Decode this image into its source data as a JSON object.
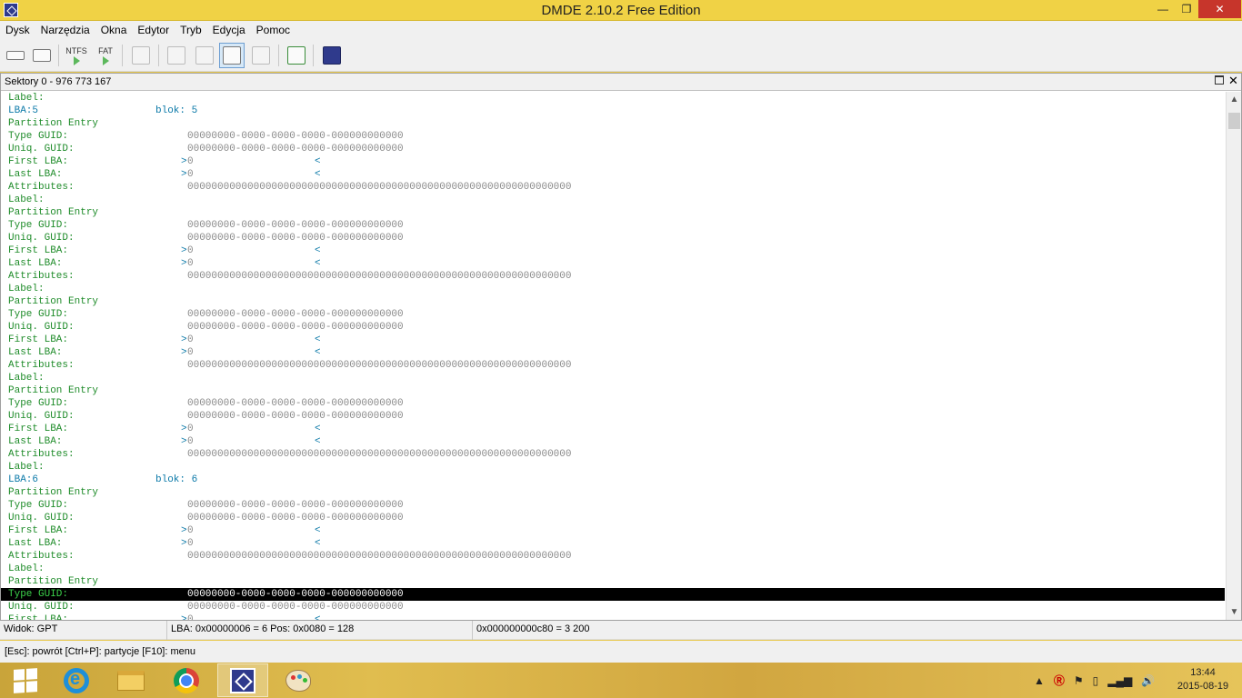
{
  "window": {
    "title": "DMDE 2.10.2 Free Edition",
    "min_glyph": "—",
    "max_glyph": "❐",
    "close_glyph": "✕"
  },
  "menu": [
    "Dysk",
    "Narzędzia",
    "Okna",
    "Edytor",
    "Tryb",
    "Edycja",
    "Pomoc"
  ],
  "toolbar": {
    "ntfs_label": "NTFS",
    "fat_label": "FAT"
  },
  "panel": {
    "title": "Sektory 0 - 976 773 167",
    "close_glyph": "✕"
  },
  "listing": {
    "guid": "00000000-0000-0000-0000-000000000000",
    "attributes": "0000000000000000000000000000000000000000000000000000000000000000",
    "lt": "<",
    "gt": ">",
    "zero": "0",
    "rows": [
      {
        "type": "label",
        "label": "Label:"
      },
      {
        "type": "lba",
        "label": "LBA:5",
        "block": "blok: 5"
      },
      {
        "type": "label",
        "label": "Partition Entry"
      },
      {
        "type": "guid",
        "label": "Type GUID:"
      },
      {
        "type": "guid",
        "label": "Uniq. GUID:"
      },
      {
        "type": "range",
        "label": "First LBA:"
      },
      {
        "type": "range",
        "label": "Last LBA:"
      },
      {
        "type": "attr",
        "label": "Attributes:"
      },
      {
        "type": "label",
        "label": "Label:"
      },
      {
        "type": "label",
        "label": "Partition Entry"
      },
      {
        "type": "guid",
        "label": "Type GUID:"
      },
      {
        "type": "guid",
        "label": "Uniq. GUID:"
      },
      {
        "type": "range",
        "label": "First LBA:"
      },
      {
        "type": "range",
        "label": "Last LBA:"
      },
      {
        "type": "attr",
        "label": "Attributes:"
      },
      {
        "type": "label",
        "label": "Label:"
      },
      {
        "type": "label",
        "label": "Partition Entry"
      },
      {
        "type": "guid",
        "label": "Type GUID:"
      },
      {
        "type": "guid",
        "label": "Uniq. GUID:"
      },
      {
        "type": "range",
        "label": "First LBA:"
      },
      {
        "type": "range",
        "label": "Last LBA:"
      },
      {
        "type": "attr",
        "label": "Attributes:"
      },
      {
        "type": "label",
        "label": "Label:"
      },
      {
        "type": "label",
        "label": "Partition Entry"
      },
      {
        "type": "guid",
        "label": "Type GUID:"
      },
      {
        "type": "guid",
        "label": "Uniq. GUID:"
      },
      {
        "type": "range",
        "label": "First LBA:"
      },
      {
        "type": "range",
        "label": "Last LBA:"
      },
      {
        "type": "attr",
        "label": "Attributes:"
      },
      {
        "type": "label",
        "label": "Label:"
      },
      {
        "type": "lba",
        "label": "LBA:6",
        "block": "blok: 6"
      },
      {
        "type": "label",
        "label": "Partition Entry"
      },
      {
        "type": "guid",
        "label": "Type GUID:"
      },
      {
        "type": "guid",
        "label": "Uniq. GUID:"
      },
      {
        "type": "range",
        "label": "First LBA:"
      },
      {
        "type": "range",
        "label": "Last LBA:"
      },
      {
        "type": "attr",
        "label": "Attributes:"
      },
      {
        "type": "label",
        "label": "Label:"
      },
      {
        "type": "label",
        "label": "Partition Entry"
      },
      {
        "type": "guid",
        "label": "Type GUID:",
        "selected": true
      },
      {
        "type": "guid",
        "label": "Uniq. GUID:"
      },
      {
        "type": "range",
        "label": "First LBA:"
      }
    ]
  },
  "status": {
    "view": "Widok: GPT",
    "position": "LBA: 0x00000006 = 6  Pos: 0x0080 = 128",
    "offset": "0x000000000c80 = 3 200"
  },
  "hint": "[Esc]: powrót  [Ctrl+P]: partycje  [F10]: menu",
  "taskbar": {
    "active_app": "dmde",
    "icons": [
      "start-icon",
      "internet-explorer-icon",
      "file-explorer-icon",
      "chrome-icon",
      "dmde-icon",
      "paint-icon"
    ]
  },
  "tray": {
    "arrow": "▲",
    "time": "13:44",
    "date": "2015-08-19"
  }
}
